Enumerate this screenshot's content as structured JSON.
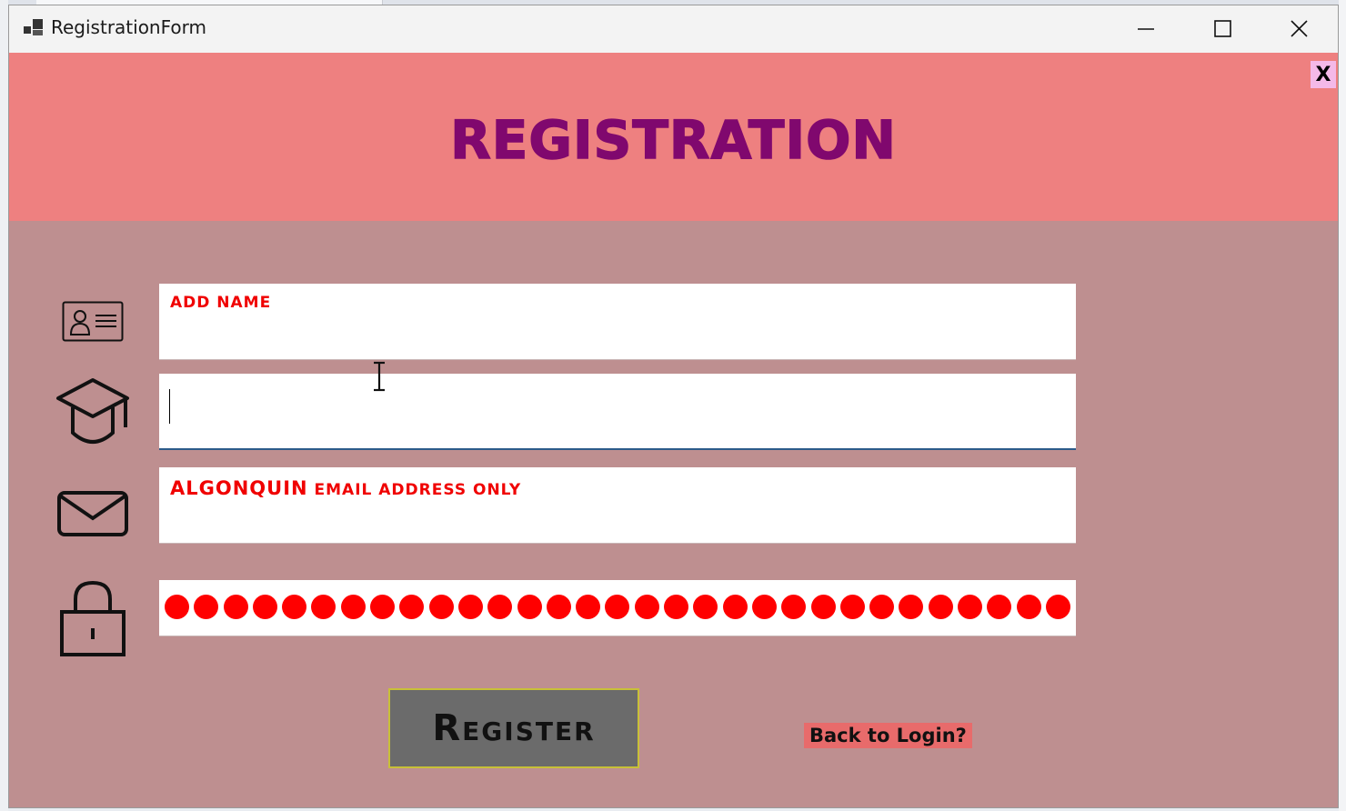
{
  "window": {
    "title": "RegistrationForm",
    "controls": {
      "minimize": "minimize-icon",
      "maximize": "maximize-icon",
      "close": "close-icon"
    }
  },
  "header": {
    "title": "REGISTRATION",
    "close_label": "X",
    "background": "#ee8080",
    "title_color": "#80086e"
  },
  "form": {
    "name_placeholder": "ADD NAME",
    "program_value": "",
    "email_placeholder_bold": "ALGONQUIN",
    "email_placeholder_rest": " EMAIL ADDRESS ONLY",
    "password_mask_count": 31,
    "register_label": "Register",
    "back_label": "Back to Login?"
  },
  "colors": {
    "body": "#be8f90",
    "placeholder": "#f00000",
    "register_bg": "#6b6b6b",
    "back_bg": "#e86b6b"
  }
}
